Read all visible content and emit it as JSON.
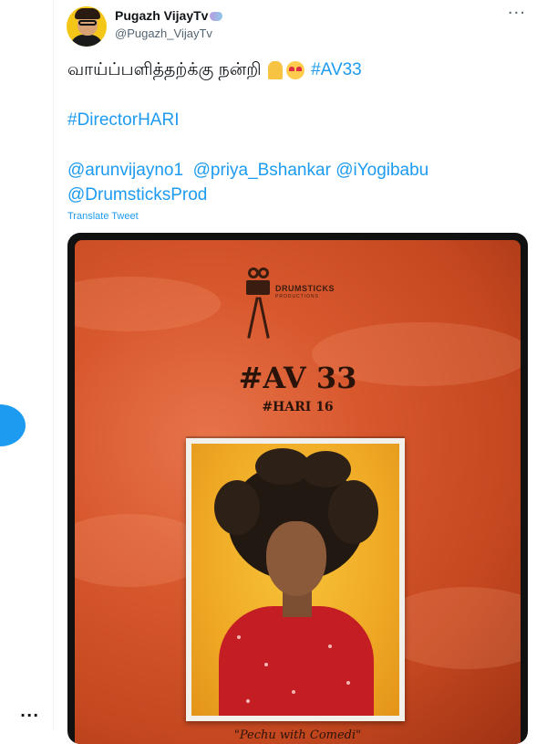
{
  "tweet": {
    "author_name": "Pugazh VijayTv",
    "author_handle": "@Pugazh_VijayTv",
    "text_line1": "வாய்ப்பளித்தற்க்கு நன்றி",
    "hashtag1": "#AV33",
    "hashtag2": "#DirectorHARI",
    "mentions_line1": [
      "@arunvijayno1",
      "@priya_Bshankar",
      "@iYogibabu"
    ],
    "mentions_line2": "@DrumsticksProd",
    "translate_label": "Translate Tweet",
    "more_menu": "···",
    "emojis": [
      "folded-hands-emoji",
      "heart-eyes-emoji"
    ]
  },
  "media": {
    "logo_title": "DRUMSTICKS",
    "logo_subtitle": "PRODUCTIONS",
    "poster_title": "#AV 33",
    "poster_subtitle": "#HARI 16",
    "poster_tagline": "\"Pechu with Comedi\""
  },
  "left_rail": {
    "more_label": "···"
  },
  "colors": {
    "accent": "#1d9bf0",
    "poster_bg": "#d8582e",
    "photo_bg": "#f0a925",
    "shirt": "#c41e24"
  }
}
